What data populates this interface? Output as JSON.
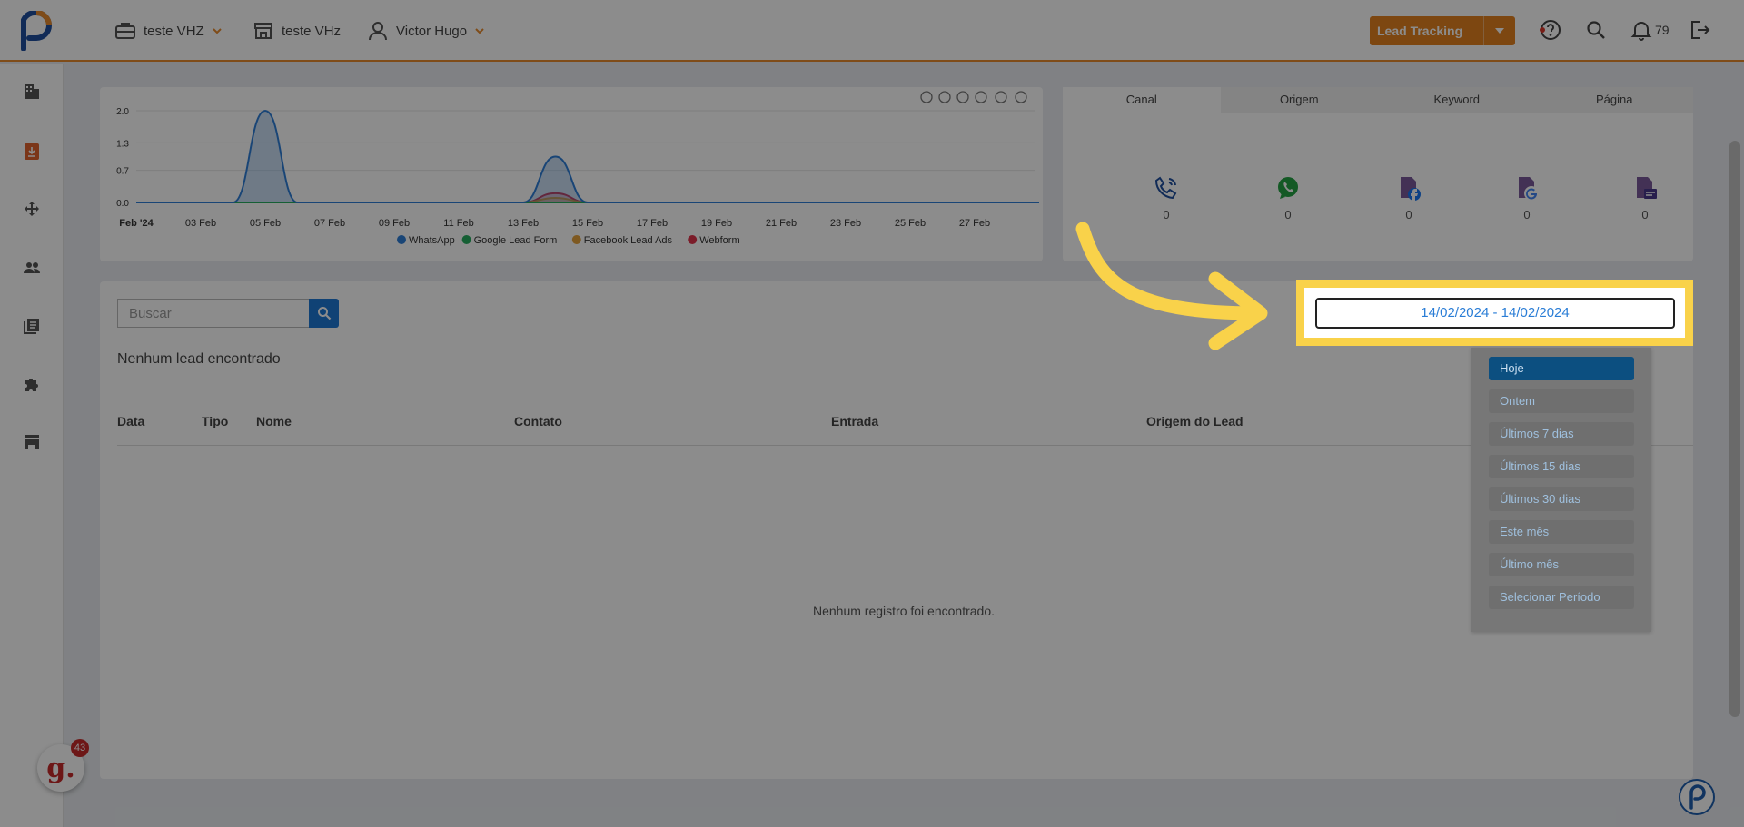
{
  "header": {
    "company": "teste VHZ",
    "store": "teste VHz",
    "user": "Victor Hugo",
    "lead_button": "Lead Tracking",
    "notifications_count": "79"
  },
  "chart_data": {
    "type": "area",
    "x_ticks": [
      "Feb '24",
      "03 Feb",
      "05 Feb",
      "07 Feb",
      "09 Feb",
      "11 Feb",
      "13 Feb",
      "15 Feb",
      "17 Feb",
      "19 Feb",
      "21 Feb",
      "23 Feb",
      "25 Feb",
      "27 Feb"
    ],
    "y_ticks": [
      "2.0",
      "1.3",
      "0.7",
      "0.0"
    ],
    "ylim": [
      0,
      2
    ],
    "legend_position": "bottom",
    "x_days": [
      1,
      3,
      4,
      5,
      6,
      7,
      9,
      11,
      13,
      14,
      15,
      17,
      19,
      21,
      23,
      25,
      27,
      29
    ],
    "series": [
      {
        "name": "WhatsApp",
        "color": "#2f7ed8",
        "values": [
          0,
          0,
          0,
          2,
          0,
          0,
          0,
          0,
          0,
          1,
          0,
          0,
          0,
          0,
          0,
          0,
          0,
          0
        ]
      },
      {
        "name": "Google Lead Form",
        "color": "#27ae60",
        "values": [
          0,
          0,
          0,
          0,
          0,
          0,
          0,
          0,
          0,
          0,
          0,
          0,
          0,
          0,
          0,
          0,
          0,
          0
        ]
      },
      {
        "name": "Facebook Lead Ads",
        "color": "#e6a23c",
        "values": [
          0,
          0,
          0,
          0,
          0,
          0,
          0,
          0,
          0,
          0.1,
          0,
          0,
          0,
          0,
          0,
          0,
          0,
          0
        ]
      },
      {
        "name": "Webform",
        "color": "#e0344c",
        "values": [
          0,
          0,
          0,
          0,
          0,
          0,
          0,
          0,
          0,
          0.2,
          0,
          0,
          0,
          0,
          0,
          0,
          0,
          0
        ]
      }
    ]
  },
  "canal": {
    "tabs": [
      "Canal",
      "Origem",
      "Keyword",
      "Página"
    ],
    "counts": [
      "0",
      "0",
      "0",
      "0",
      "0"
    ]
  },
  "leads": {
    "search_placeholder": "Buscar",
    "empty_title": "Nenhum lead encontrado",
    "columns": [
      "Data",
      "Tipo",
      "Nome",
      "Contato",
      "Entrada",
      "Origem do Lead"
    ],
    "empty_message": "Nenhum registro foi encontrado."
  },
  "daterange": {
    "value": "14/02/2024 - 14/02/2024",
    "options": [
      "Hoje",
      "Ontem",
      "Últimos 7 dias",
      "Últimos 15 dias",
      "Últimos 30 dias",
      "Este mês",
      "Último mês",
      "Selecionar Período"
    ],
    "selected": "Hoje"
  },
  "grammarly_count": "43"
}
